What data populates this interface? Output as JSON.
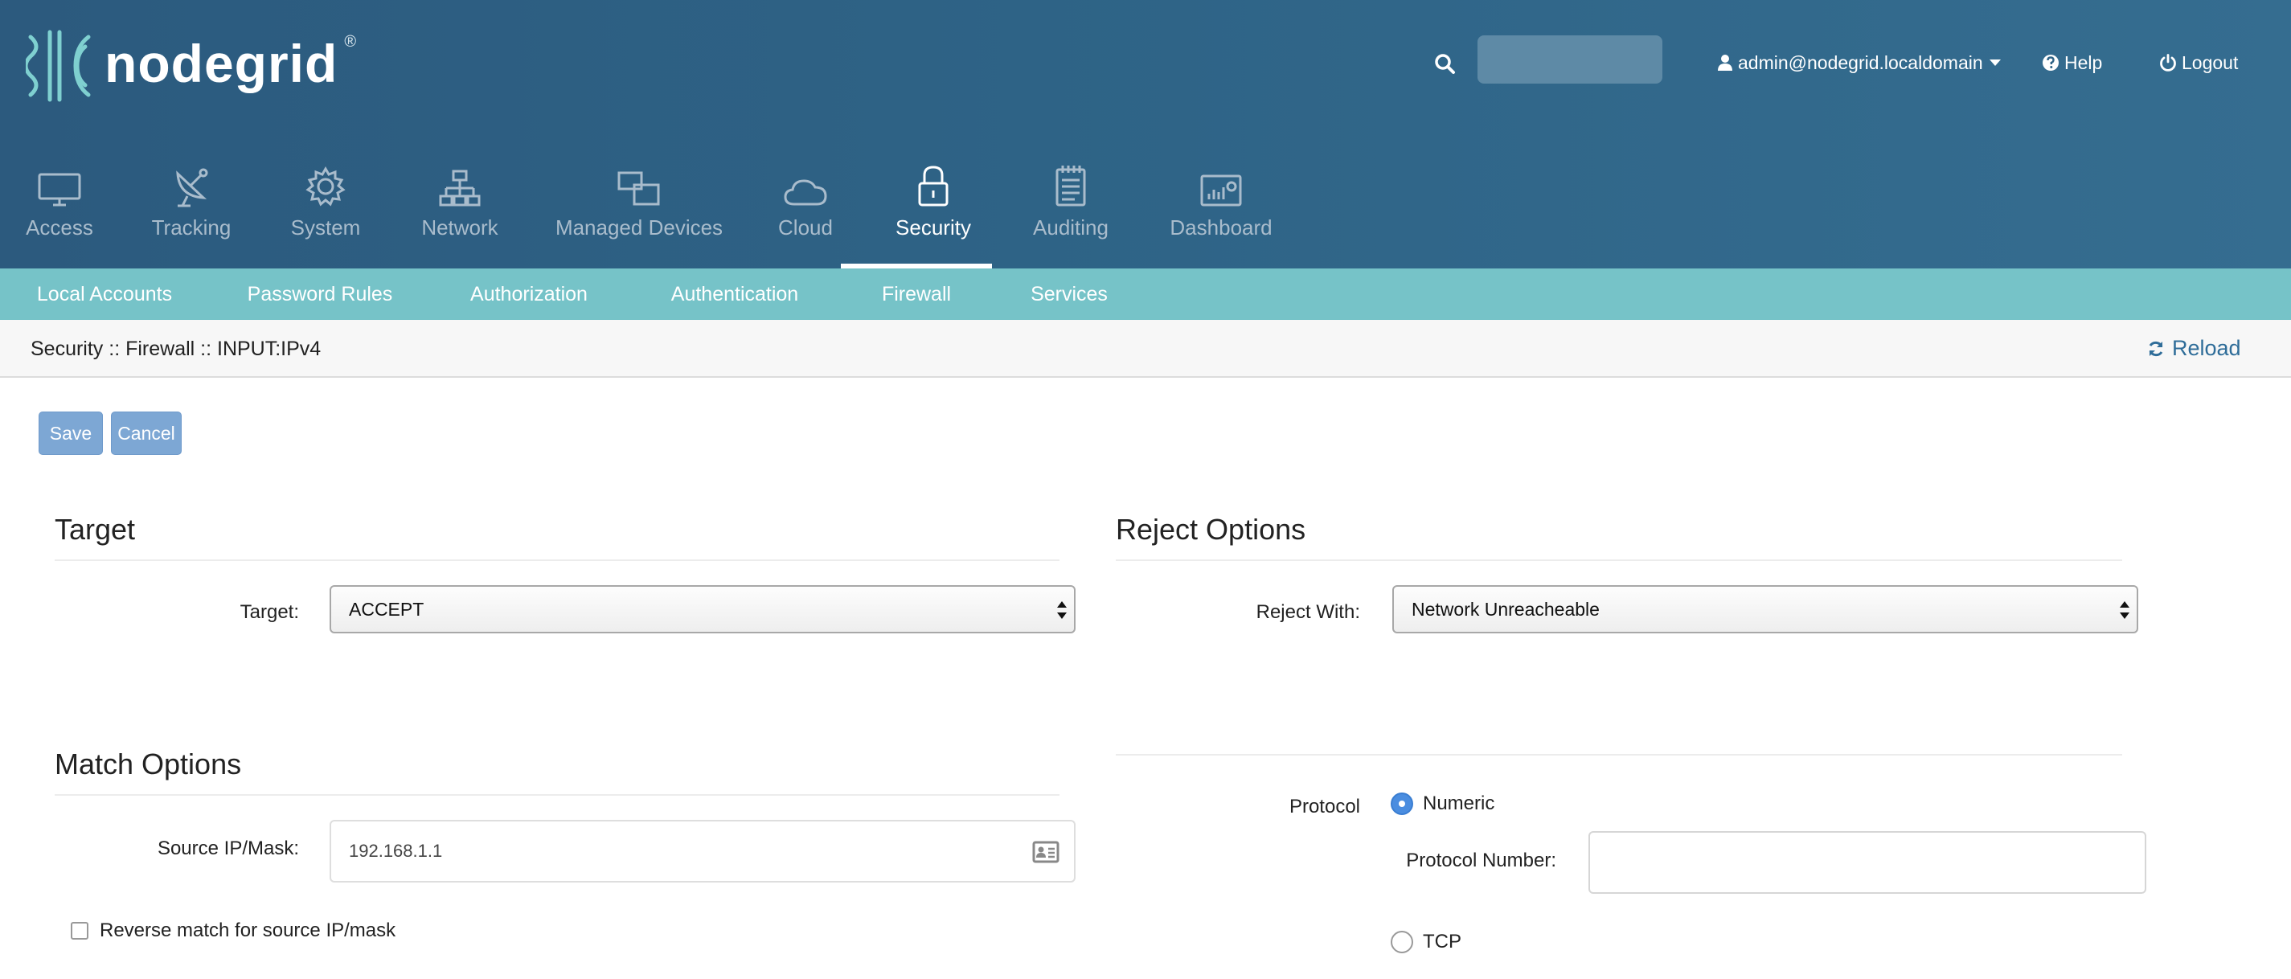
{
  "brand": {
    "name": "nodegrid",
    "reg": "®"
  },
  "header": {
    "search_placeholder": "",
    "user": "admin@nodegrid.localdomain",
    "help": "Help",
    "logout": "Logout"
  },
  "main_nav": {
    "items": [
      {
        "label": "Access",
        "icon": "monitor-icon"
      },
      {
        "label": "Tracking",
        "icon": "satellite-dish-icon"
      },
      {
        "label": "System",
        "icon": "gear-icon"
      },
      {
        "label": "Network",
        "icon": "network-topology-icon"
      },
      {
        "label": "Managed Devices",
        "icon": "devices-icon"
      },
      {
        "label": "Cloud",
        "icon": "cloud-icon"
      },
      {
        "label": "Security",
        "icon": "lock-icon"
      },
      {
        "label": "Auditing",
        "icon": "notepad-icon"
      },
      {
        "label": "Dashboard",
        "icon": "dashboard-chart-icon"
      }
    ],
    "active": "Security"
  },
  "sub_nav": {
    "items": [
      "Local Accounts",
      "Password Rules",
      "Authorization",
      "Authentication",
      "Firewall",
      "Services"
    ],
    "active": "Firewall"
  },
  "breadcrumb": "Security :: Firewall :: INPUT:IPv4",
  "reload_label": "Reload",
  "actions": {
    "save": "Save",
    "cancel": "Cancel"
  },
  "target_section": {
    "title": "Target",
    "target_label": "Target:",
    "target_value": "ACCEPT"
  },
  "reject_section": {
    "title": "Reject Options",
    "reject_label": "Reject With:",
    "reject_value": "Network Unreacheable"
  },
  "match_section": {
    "title": "Match Options",
    "source_label": "Source IP/Mask:",
    "source_value": "192.168.1.1",
    "reverse_label": "Reverse match for source IP/mask",
    "reverse_checked": false
  },
  "protocol": {
    "label": "Protocol",
    "numeric_label": "Numeric",
    "protocol_number_label": "Protocol Number:",
    "protocol_number_value": "",
    "tcp_label": "TCP",
    "selected": "Numeric"
  },
  "colors": {
    "header_bg": "#2e6386",
    "subnav_bg": "#76c3c8",
    "button_bg": "#7da7d4",
    "accent_link": "#2f6d99",
    "radio_on": "#4a8de0"
  }
}
